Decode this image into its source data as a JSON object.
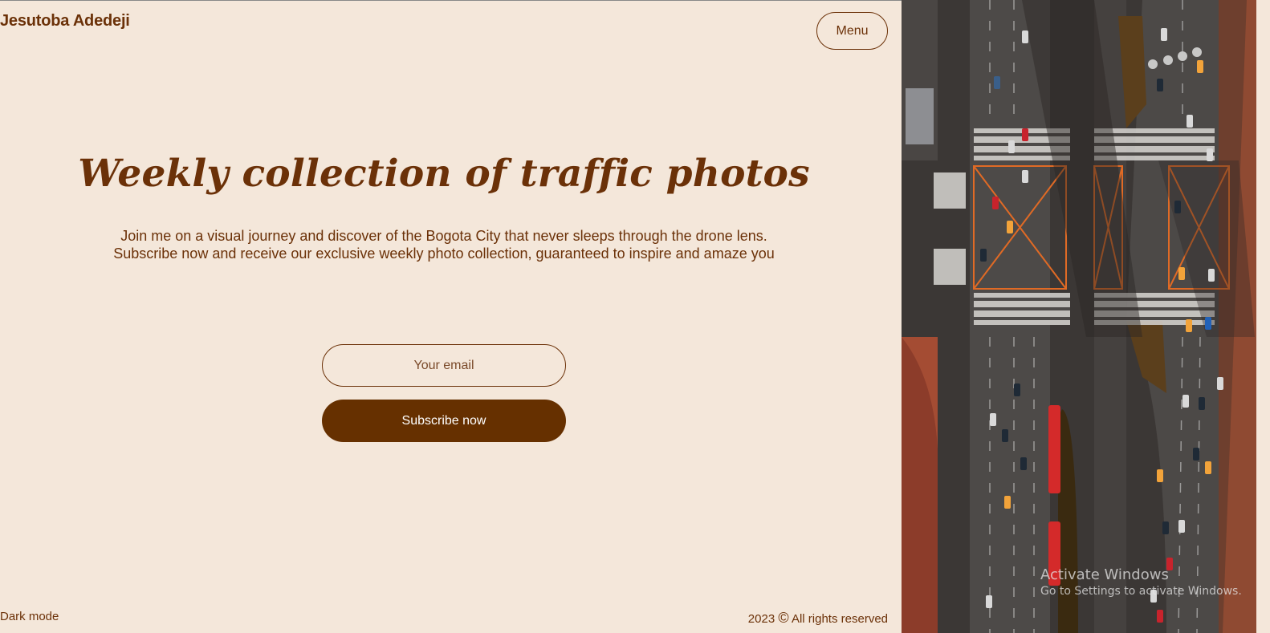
{
  "header": {
    "brand": "Jesutoba Adedeji",
    "menu_label": "Menu"
  },
  "hero": {
    "title": "Weekly collection of traffic photos",
    "subtitle": "Join me on a visual journey and discover of the Bogota City that never sleeps through the drone lens. Subscribe now and receive our exclusive weekly photo collection, guaranteed to inspire and amaze you"
  },
  "form": {
    "email_placeholder": "Your email",
    "email_value": "",
    "subscribe_label": "Subscribe now"
  },
  "footer": {
    "dark_mode_label": "Dark mode",
    "copyright_year": "2023",
    "copyright_symbol": "©",
    "copyright_text": "All rights reserved"
  },
  "watermark": {
    "line1": "Activate Windows",
    "line2": "Go to Settings to activate Windows."
  },
  "colors": {
    "background": "#f4e7da",
    "accent": "#663000",
    "text": "#6b3108"
  },
  "image": {
    "subject": "aerial-traffic-photo-icon"
  }
}
